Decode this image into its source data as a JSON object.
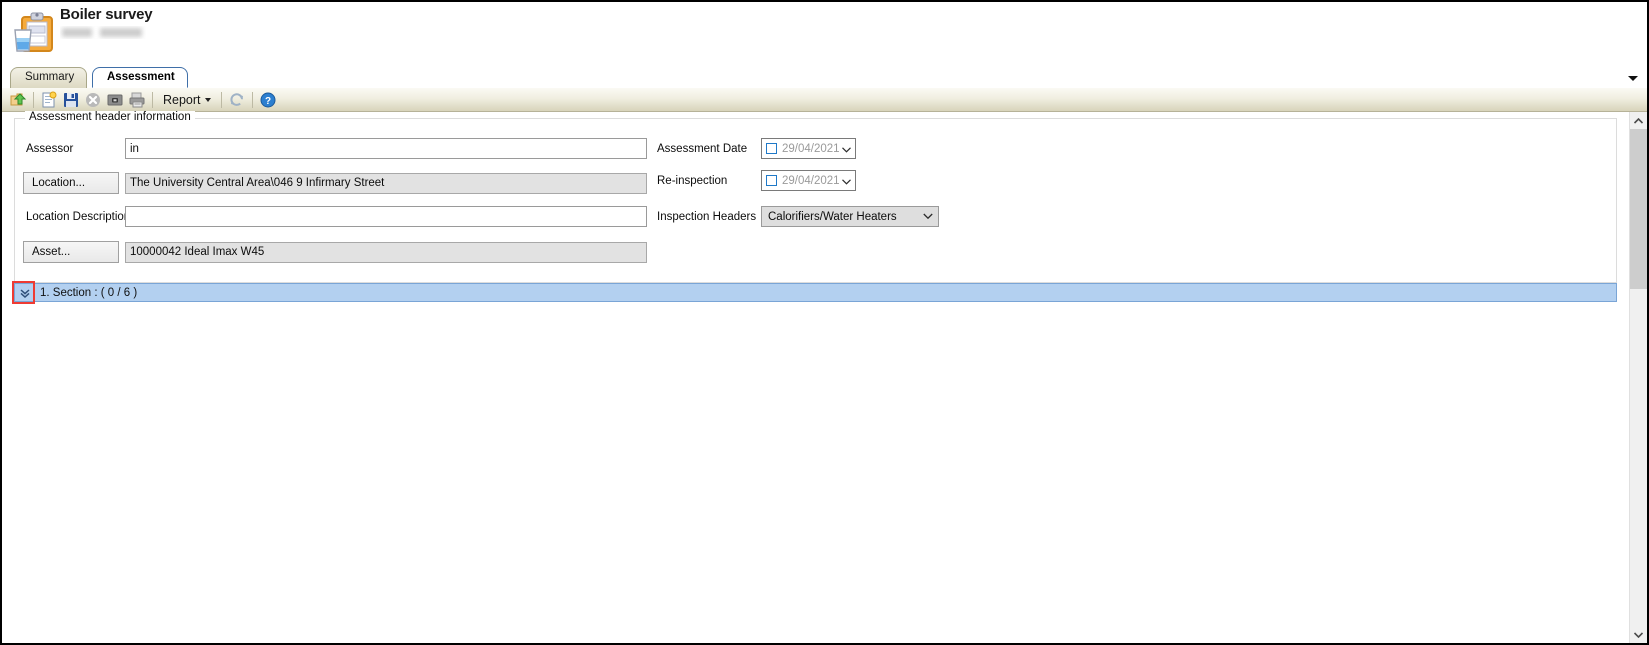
{
  "window": {
    "app_icon": "clipboard-water-icon",
    "title": "Boiler survey",
    "subtitle_redacted": ""
  },
  "tabs": [
    {
      "label": "Summary",
      "active": false
    },
    {
      "label": "Assessment",
      "active": true
    }
  ],
  "tab_overflow_icon": "chevron-down-icon",
  "toolbar": {
    "buttons": [
      {
        "name": "back-icon",
        "label": "Back"
      },
      {
        "name": "new-document-icon",
        "label": "New"
      },
      {
        "name": "save-icon",
        "label": "Save"
      },
      {
        "name": "delete-icon",
        "label": "Delete"
      },
      {
        "name": "camera-photo-icon",
        "label": "Photo"
      },
      {
        "name": "print-icon",
        "label": "Print"
      }
    ],
    "report_label": "Report",
    "report_caret_icon": "caret-down-icon",
    "refresh_icon": "refresh-icon",
    "help_icon": "help-icon"
  },
  "groupbox": {
    "title": "Assessment header information"
  },
  "form": {
    "assessor": {
      "label": "Assessor",
      "value": "in",
      "placeholder": ""
    },
    "location": {
      "button_label": "Location...",
      "value": "The University Central Area\\046 9 Infirmary Street"
    },
    "location_description": {
      "label": "Location Description",
      "value": "",
      "placeholder": ""
    },
    "asset": {
      "button_label": "Asset...",
      "value": "10000042 Ideal Imax W45"
    },
    "assessment_date": {
      "label": "Assessment Date",
      "value": "29/04/2021",
      "checked": false,
      "checkbox_icon": "checkbox-unchecked-icon",
      "dropdown_icon": "chevron-down-icon"
    },
    "reinspection": {
      "label": "Re-inspection",
      "value": "29/04/2021",
      "checked": false,
      "checkbox_icon": "checkbox-unchecked-icon",
      "dropdown_icon": "chevron-down-icon"
    },
    "inspection_headers": {
      "label": "Inspection Headers",
      "value": "Calorifiers/Water Heaters",
      "dropdown_icon": "chevron-down-icon"
    }
  },
  "section": {
    "expand_icon": "double-chevron-down-icon",
    "label": "1. Section : ( 0 / 6 )",
    "highlight_color": "#ee3b33",
    "row_color": "#b3d0f0"
  },
  "scrollbar": {
    "up_icon": "chevron-up-icon",
    "down_icon": "chevron-down-icon"
  }
}
